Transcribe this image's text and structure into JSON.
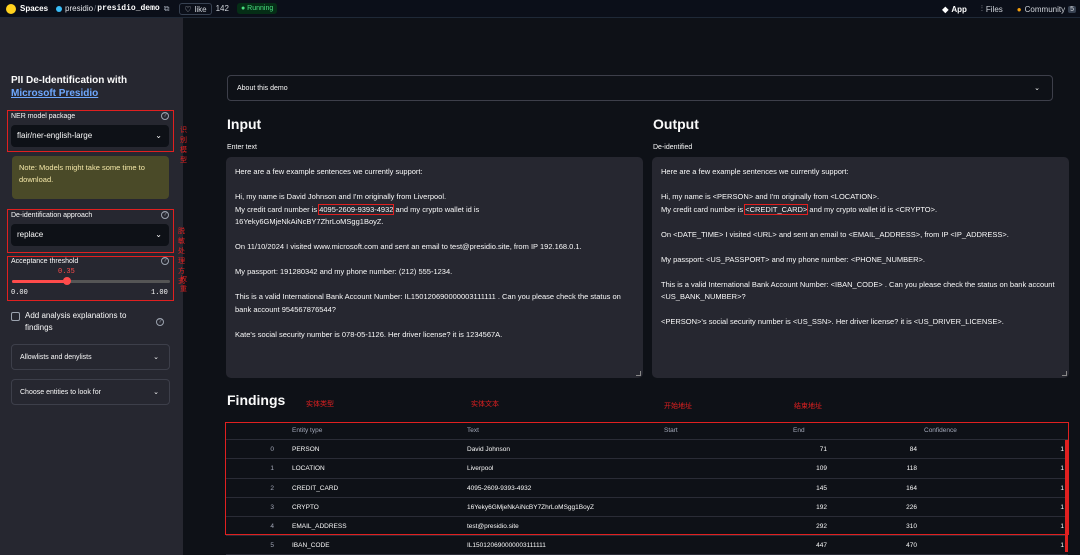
{
  "topbar": {
    "spaces": "Spaces",
    "owner": "presidio",
    "repo": "presidio_demo",
    "like_label": "like",
    "like_count": "142",
    "status": "Running",
    "nav": [
      {
        "label": "App",
        "icon": "app-icon"
      },
      {
        "label": "Files",
        "icon": "files-icon"
      },
      {
        "label": "Community",
        "icon": "community-icon",
        "badge": "5"
      }
    ]
  },
  "sidebar": {
    "title_line1": "PII De-Identification with",
    "title_link": "Microsoft Presidio",
    "ner_label": "NER model package",
    "ner_value": "flair/ner-english-large",
    "ner_annotation": "识别模型",
    "note": "Note: Models might take some time to download.",
    "approach_label": "De-identification approach",
    "approach_value": "replace",
    "approach_annotation": "脱敏处理方式",
    "threshold_label": "Acceptance threshold",
    "threshold_value": "0.35",
    "threshold_fraction": 0.35,
    "threshold_min": "0.00",
    "threshold_max": "1.00",
    "threshold_annotation": "权重",
    "checkbox_label": "Add analysis explanations to findings",
    "allow_deny": "Allowlists and denylists",
    "entities": "Choose entities to look for"
  },
  "main": {
    "about": "About this demo",
    "input_title": "Input",
    "input_label": "Enter text",
    "output_title": "Output",
    "output_label": "De-identified",
    "input_text": {
      "p1": "Here are a few example sentences we currently support:",
      "p2a": "Hi, my name is David Johnson and I'm originally from Liverpool.",
      "p2b_pre": "My credit card number is ",
      "p2b_hl": "4095-2609-9393-4932",
      "p2b_post": " and my crypto wallet id is",
      "p2c": "16Yeky6GMjeNkAiNcBY7ZhrLoMSgg1BoyZ.",
      "p3": "On 11/10/2024 I visited www.microsoft.com and sent an email to test@presidio.site,  from IP 192.168.0.1.",
      "p4": "My passport: 191280342 and my phone number: (212) 555-1234.",
      "p5": "This is a valid International Bank Account Number: IL150120690000003111111 . Can you please check the status on bank account 954567876544?",
      "p6": "Kate's social security number is 078-05-1126.  Her driver license? it is 1234567A."
    },
    "output_text": {
      "p1": "Here are a few example sentences we currently support:",
      "p2a": "Hi, my name is <PERSON> and I'm originally from <LOCATION>.",
      "p2b_pre": "My credit card number is ",
      "p2b_hl": "<CREDIT_CARD>",
      "p2b_post": " and my crypto wallet id is <CRYPTO>.",
      "p3": "On <DATE_TIME> I visited <URL> and sent an email to <EMAIL_ADDRESS>,  from IP <IP_ADDRESS>.",
      "p4": "My passport: <US_PASSPORT> and my phone number: <PHONE_NUMBER>.",
      "p5": "This is a valid International Bank Account Number: <IBAN_CODE> . Can you please check the status on bank account <US_BANK_NUMBER>?",
      "p6": "<PERSON>'s social security number is <US_SSN>.  Her driver license? it is <US_DRIVER_LICENSE>."
    },
    "findings_title": "Findings",
    "annotations": {
      "entity_type": "实体类型",
      "entity_text": "实体文本",
      "start": "开始地址",
      "end": "结束地址"
    },
    "columns": [
      "Entity type",
      "Text",
      "Start",
      "End",
      "Confidence"
    ],
    "rows": [
      {
        "idx": "0",
        "type": "PERSON",
        "text": "David Johnson",
        "start": "71",
        "end": "84",
        "conf": "1"
      },
      {
        "idx": "1",
        "type": "LOCATION",
        "text": "Liverpool",
        "start": "109",
        "end": "118",
        "conf": "1"
      },
      {
        "idx": "2",
        "type": "CREDIT_CARD",
        "text": "4095-2609-9393-4932",
        "start": "145",
        "end": "164",
        "conf": "1"
      },
      {
        "idx": "3",
        "type": "CRYPTO",
        "text": "16Yeky6GMjeNkAiNcBY7ZhrLoMSgg1BoyZ",
        "start": "192",
        "end": "226",
        "conf": "1"
      },
      {
        "idx": "4",
        "type": "EMAIL_ADDRESS",
        "text": "test@presidio.site",
        "start": "292",
        "end": "310",
        "conf": "1"
      },
      {
        "idx": "5",
        "type": "IBAN_CODE",
        "text": "IL150120690000003111111",
        "start": "447",
        "end": "470",
        "conf": "1"
      }
    ]
  },
  "colors": {
    "accent": "#ff4b4b",
    "annotation_red": "#e02020",
    "link": "#6ea8ff",
    "note_bg": "#4a4a28"
  }
}
